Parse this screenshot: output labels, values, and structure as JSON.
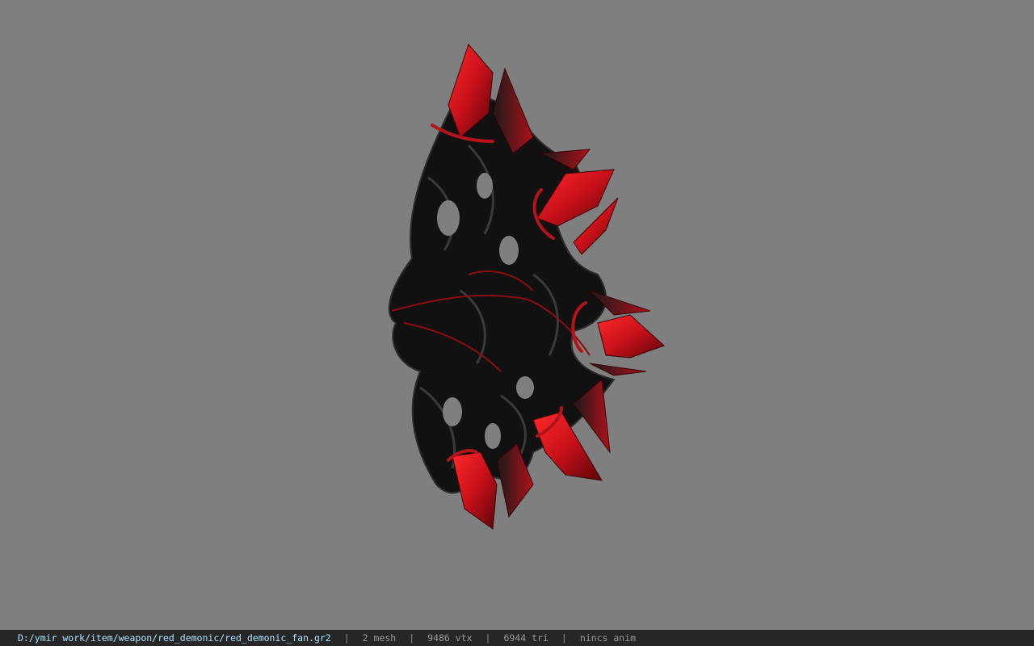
{
  "viewer": {
    "background_color": "#7f7f7f",
    "model_icon": "red-demonic-fan-model",
    "accent_color": "#c8101a"
  },
  "status": {
    "file_path": "D:/ymir work/item/weapon/red_demonic/red_demonic_fan.gr2",
    "separator": "|",
    "mesh": "2 mesh",
    "vtx": "9486 vtx",
    "tri": "6944 tri",
    "anim": "nincs anim",
    "path_color": "#aee4ff"
  }
}
